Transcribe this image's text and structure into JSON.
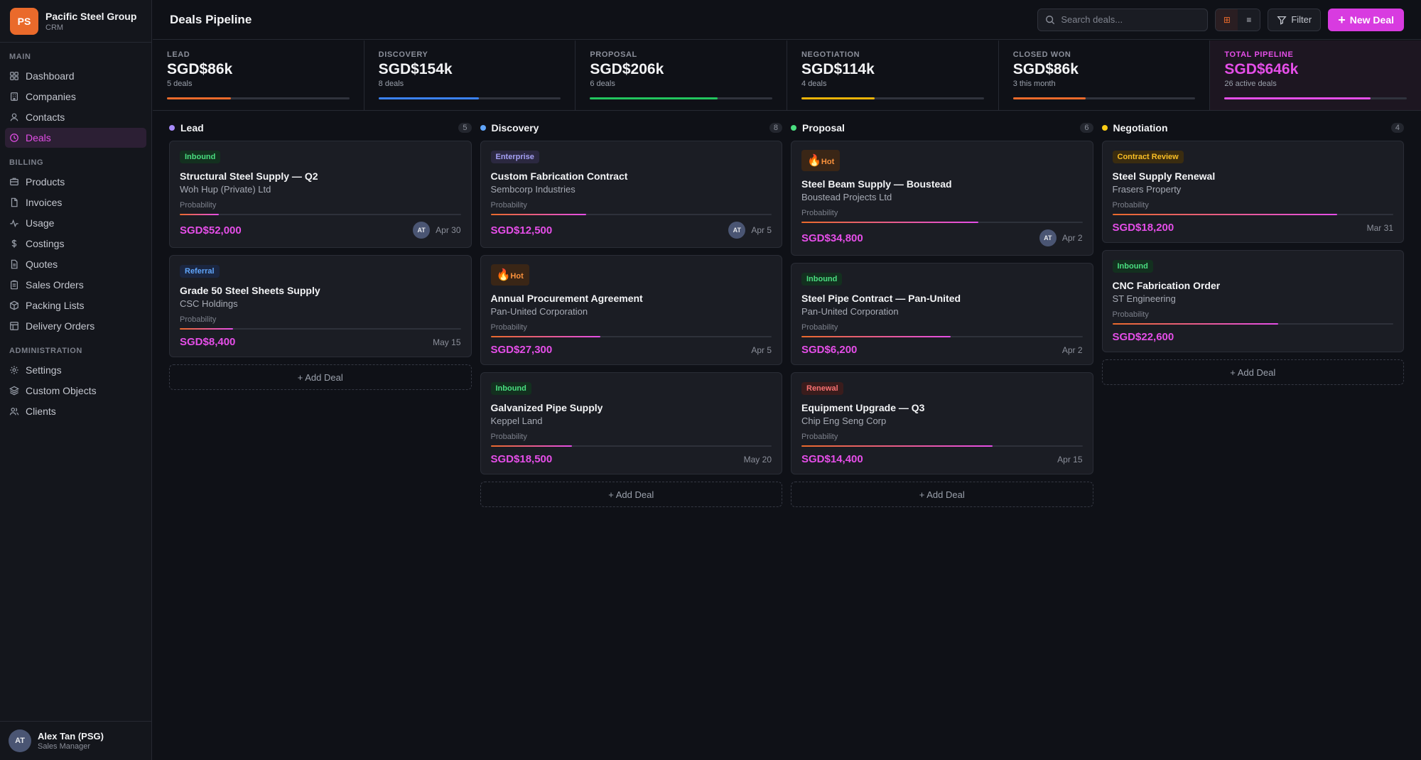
{
  "brand": {
    "initials": "PS",
    "name": "Pacific Steel Group",
    "sub": "CRM"
  },
  "nav": {
    "sections": [
      {
        "heading": "MAIN",
        "items": [
          {
            "label": "Dashboard",
            "icon": "grid-icon"
          },
          {
            "label": "Companies",
            "icon": "building-icon"
          },
          {
            "label": "Contacts",
            "icon": "user-icon"
          },
          {
            "label": "Deals",
            "icon": "clock-icon",
            "active": true
          }
        ]
      },
      {
        "heading": "BILLING",
        "items": [
          {
            "label": "Products",
            "icon": "box-icon"
          },
          {
            "label": "Invoices",
            "icon": "file-icon"
          },
          {
            "label": "Usage",
            "icon": "activity-icon"
          },
          {
            "label": "Costings",
            "icon": "dollar-icon"
          },
          {
            "label": "Quotes",
            "icon": "document-icon"
          },
          {
            "label": "Sales Orders",
            "icon": "clipboard-icon"
          },
          {
            "label": "Packing Lists",
            "icon": "package-icon"
          },
          {
            "label": "Delivery Orders",
            "icon": "truck-icon"
          }
        ]
      },
      {
        "heading": "ADMINISTRATION",
        "items": [
          {
            "label": "Settings",
            "icon": "gear-icon"
          },
          {
            "label": "Custom Objects",
            "icon": "layers-icon"
          },
          {
            "label": "Clients",
            "icon": "users-icon"
          }
        ]
      }
    ]
  },
  "user": {
    "initials": "AT",
    "name": "Alex Tan (PSG)",
    "role": "Sales Manager"
  },
  "header": {
    "title": "Deals Pipeline",
    "search_placeholder": "Search deals...",
    "filter_label": "Filter",
    "new_label": "New Deal",
    "view_grid_glyph": "⊞",
    "view_list_glyph": "≡"
  },
  "stats": [
    {
      "label": "LEAD",
      "value": "SGD$86k",
      "sub": "5 deals",
      "fill": 0.35,
      "color": "#ea6a2b"
    },
    {
      "label": "DISCOVERY",
      "value": "SGD$154k",
      "sub": "8 deals",
      "fill": 0.55,
      "color": "#3b82f6"
    },
    {
      "label": "PROPOSAL",
      "value": "SGD$206k",
      "sub": "6 deals",
      "fill": 0.7,
      "color": "#22c55e"
    },
    {
      "label": "NEGOTIATION",
      "value": "SGD$114k",
      "sub": "4 deals",
      "fill": 0.4,
      "color": "#eab308"
    },
    {
      "label": "CLOSED WON",
      "value": "SGD$86k",
      "sub": "3 this month",
      "fill": 0.4,
      "color": "#ea6a2b"
    },
    {
      "label": "TOTAL PIPELINE",
      "value": "SGD$646k",
      "sub": "26 active deals",
      "fill": 0.8,
      "color": "#e54ee8",
      "total": true
    }
  ],
  "add_deal_label": "+ Add Deal",
  "probability_label": "Probability",
  "columns": [
    {
      "title": "Lead",
      "count": "5",
      "dot": "#a78bfa",
      "cards": [
        {
          "tag": "Inbound",
          "tag_type": "inbound",
          "title": "Structural Steel Supply — Q2",
          "company": "Woh Hup (Private) Ltd",
          "prob": 0.14,
          "amount": "SGD$52,000",
          "avatar": "AT",
          "date": "Apr 30"
        },
        {
          "tag": "Referral",
          "tag_type": "referral",
          "title": "Grade 50 Steel Sheets Supply",
          "company": "CSC Holdings",
          "prob": 0.19,
          "amount": "SGD$8,400",
          "avatar": "",
          "date": "May 15"
        }
      ]
    },
    {
      "title": "Discovery",
      "count": "8",
      "dot": "#60a5fa",
      "cards": [
        {
          "tag": "Enterprise",
          "tag_type": "enterprise",
          "title": "Custom Fabrication Contract",
          "company": "Sembcorp Industries",
          "prob": 0.34,
          "amount": "SGD$12,500",
          "avatar": "AT",
          "date": "Apr 5"
        },
        {
          "tag": "Hot",
          "tag_type": "hot",
          "title": "Annual Procurement Agreement",
          "company": "Pan-United Corporation",
          "prob": 0.39,
          "amount": "SGD$27,300",
          "avatar": "",
          "date": "Apr 5"
        },
        {
          "tag": "Inbound",
          "tag_type": "inbound",
          "title": "Galvanized Pipe Supply",
          "company": "Keppel Land",
          "prob": 0.29,
          "amount": "SGD$18,500",
          "avatar": "",
          "date": "May 20"
        }
      ]
    },
    {
      "title": "Proposal",
      "count": "6",
      "dot": "#4ade80",
      "cards": [
        {
          "tag": "Hot",
          "tag_type": "hot",
          "title": "Steel Beam Supply — Boustead",
          "company": "Boustead Projects Ltd",
          "prob": 0.63,
          "amount": "SGD$34,800",
          "avatar": "AT",
          "date": "Apr 2"
        },
        {
          "tag": "Inbound",
          "tag_type": "inbound",
          "title": "Steel Pipe Contract — Pan-United",
          "company": "Pan-United Corporation",
          "prob": 0.53,
          "amount": "SGD$6,200",
          "avatar": "",
          "date": "Apr 2"
        },
        {
          "tag": "Renewal",
          "tag_type": "renewal",
          "title": "Equipment Upgrade — Q3",
          "company": "Chip Eng Seng Corp",
          "prob": 0.68,
          "amount": "SGD$14,400",
          "avatar": "",
          "date": "Apr 15"
        }
      ]
    },
    {
      "title": "Negotiation",
      "count": "4",
      "dot": "#facc15",
      "cards": [
        {
          "tag": "Contract Review",
          "tag_type": "review",
          "title": "Steel Supply Renewal",
          "company": "Frasers Property",
          "prob": 0.8,
          "amount": "SGD$18,200",
          "avatar": "",
          "date": "Mar 31"
        },
        {
          "tag": "Inbound",
          "tag_type": "inbound",
          "title": "CNC Fabrication Order",
          "company": "ST Engineering",
          "prob": 0.59,
          "amount": "SGD$22,600",
          "avatar": "",
          "date": ""
        }
      ]
    }
  ]
}
